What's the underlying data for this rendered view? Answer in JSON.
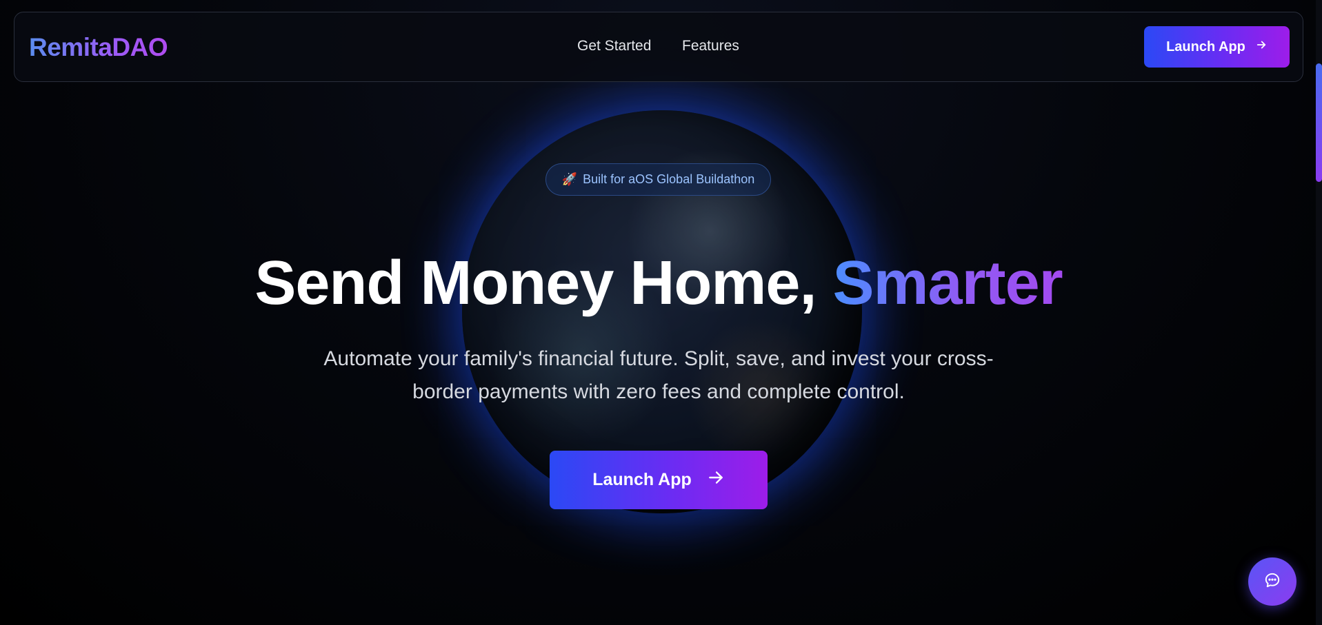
{
  "brand": {
    "logo_text": "RemitaDAO",
    "accent_colors": [
      "#5b8def",
      "#9b5cf6"
    ]
  },
  "nav": {
    "links": [
      {
        "label": "Get Started"
      },
      {
        "label": "Features"
      }
    ],
    "cta_label": "Launch App",
    "cta_icon": "arrow-right-icon"
  },
  "badge": {
    "icon": "rocket-icon",
    "icon_glyph": "🚀",
    "label": "Built for aOS Global Buildathon"
  },
  "hero": {
    "title_main": "Send Money Home,",
    "title_accent": "Smarter",
    "subtitle": "Automate your family's financial future. Split, save, and invest your cross-border payments with zero fees and complete control.",
    "cta_label": "Launch App",
    "cta_icon": "arrow-right-icon"
  },
  "chat": {
    "icon": "chat-bubble-icon"
  },
  "colors": {
    "background": "#000000",
    "button_gradient_start": "#2b49f5",
    "button_gradient_end": "#9d1de9",
    "badge_text": "#9cc4ff"
  }
}
